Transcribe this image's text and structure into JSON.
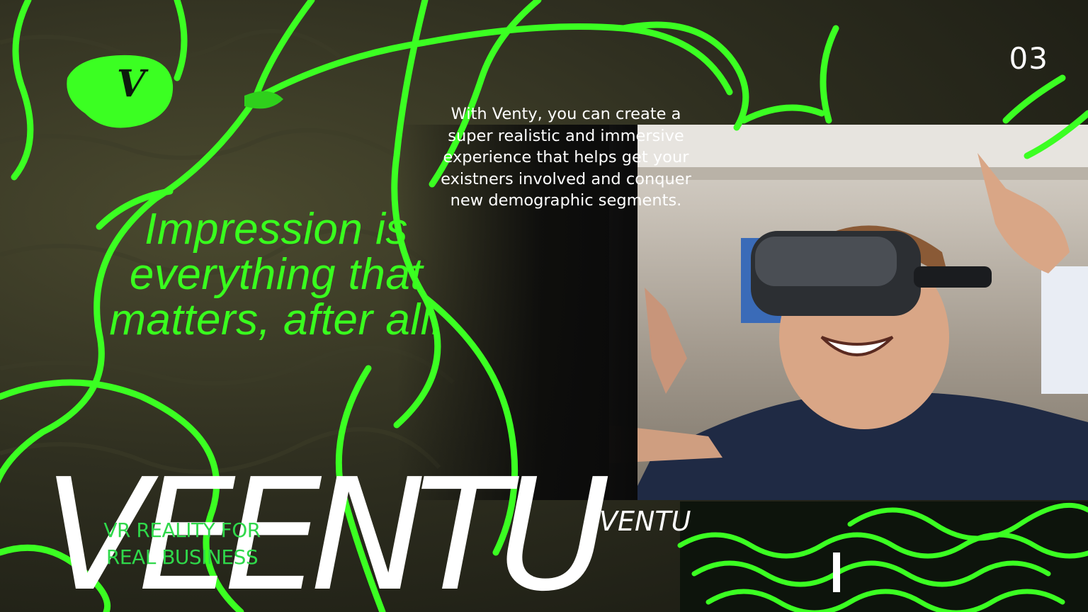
{
  "slide": {
    "number": "03",
    "logo_letter": "V",
    "headline": "Impression is everything that matters, after all.",
    "body": "With Venty, you can create a super realistic and immersive experience that helps get your existners involved and conquer new demographic segments.",
    "brand_large": "VEENTU",
    "brand_small": "VENTU",
    "tagline": "VR REALITY FOR REAL BUSINESS"
  },
  "colors": {
    "accent_green": "#39ff1e",
    "background": "#2b2b1d",
    "text_white": "#ffffff"
  },
  "icons": {
    "logo": "v-logo-blob-icon"
  }
}
